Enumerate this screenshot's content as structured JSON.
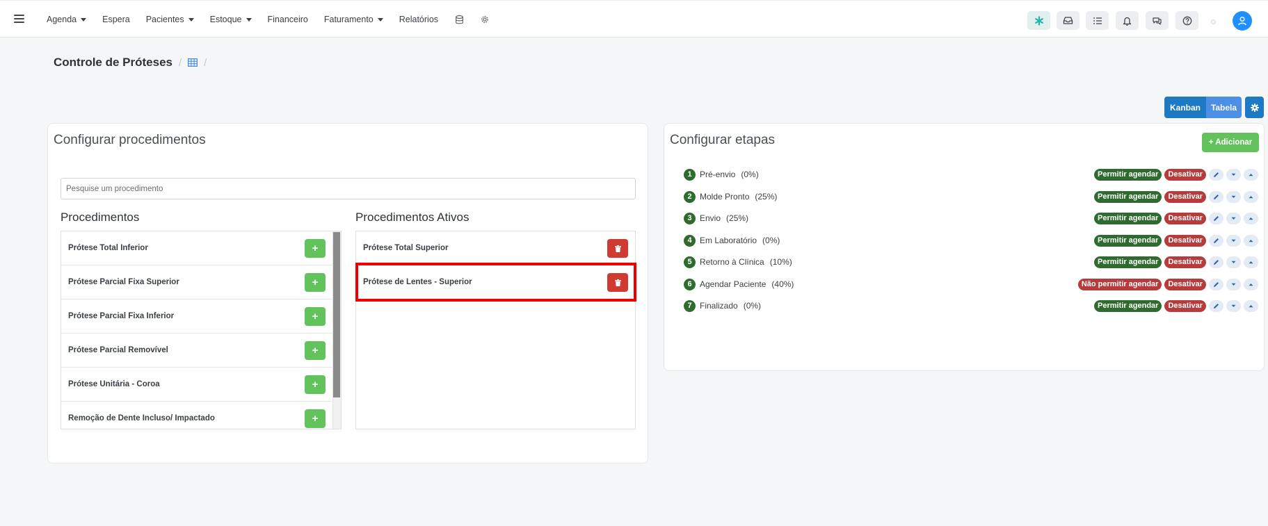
{
  "nav": {
    "menu": [
      {
        "label": "Agenda",
        "caret": true,
        "name": "menu-agenda"
      },
      {
        "label": "Espera",
        "caret": false,
        "name": "menu-espera"
      },
      {
        "label": "Pacientes",
        "caret": true,
        "name": "menu-pacientes"
      },
      {
        "label": "Estoque",
        "caret": true,
        "name": "menu-estoque"
      },
      {
        "label": "Financeiro",
        "caret": false,
        "name": "menu-financeiro"
      },
      {
        "label": "Faturamento",
        "caret": true,
        "name": "menu-faturamento"
      },
      {
        "label": "Relatórios",
        "caret": false,
        "name": "menu-relatorios"
      }
    ],
    "extra_icons": [
      "database-icon",
      "gear-icon"
    ],
    "toolbar_icons": [
      "asterisk-icon",
      "inbox-icon",
      "checklist-icon",
      "bell-icon",
      "chat-icon",
      "help-icon"
    ]
  },
  "breadcrumb": {
    "title": "Controle de Próteses",
    "sep": "/",
    "icon": "table-icon"
  },
  "view_toggle": {
    "kanban": "Kanban",
    "tabela": "Tabela"
  },
  "left_card": {
    "title": "Configurar procedimentos",
    "search_placeholder": "Pesquise um procedimento",
    "procedures_title": "Procedimentos",
    "active_title": "Procedimentos Ativos",
    "procedures": [
      "Prótese Total Inferior",
      "Prótese Parcial Fixa Superior",
      "Prótese Parcial Fixa Inferior",
      "Prótese Parcial Removível",
      "Prótese Unitária - Coroa",
      "Remoção de Dente Incluso/ Impactado"
    ],
    "active_procedures": [
      "Prótese Total Superior",
      "Prótese de Lentes - Superior"
    ],
    "add_symbol": "+"
  },
  "right_card": {
    "title": "Configurar etapas",
    "add_label": "+ Adicionar",
    "stages": [
      {
        "num": "1",
        "name": "Pré-envio",
        "pct": "(0%)",
        "schedule": "Permitir agendar",
        "allowed": true
      },
      {
        "num": "2",
        "name": "Molde Pronto",
        "pct": "(25%)",
        "schedule": "Permitir agendar",
        "allowed": true
      },
      {
        "num": "3",
        "name": "Envio",
        "pct": "(25%)",
        "schedule": "Permitir agendar",
        "allowed": true
      },
      {
        "num": "4",
        "name": "Em Laboratório",
        "pct": "(0%)",
        "schedule": "Permitir agendar",
        "allowed": true
      },
      {
        "num": "5",
        "name": "Retorno à Clínica",
        "pct": "(10%)",
        "schedule": "Permitir agendar",
        "allowed": true
      },
      {
        "num": "6",
        "name": "Agendar Paciente",
        "pct": "(40%)",
        "schedule": "Não permitir agendar",
        "allowed": false
      },
      {
        "num": "7",
        "name": "Finalizado",
        "pct": "(0%)",
        "schedule": "Permitir agendar",
        "allowed": true
      }
    ],
    "deactivate_label": "Desativar"
  },
  "colors": {
    "green": "#62c25b",
    "dark_green": "#2f6b2f",
    "red": "#cf3b30",
    "primary": "#1c79c4",
    "highlight": "#ee0000"
  }
}
